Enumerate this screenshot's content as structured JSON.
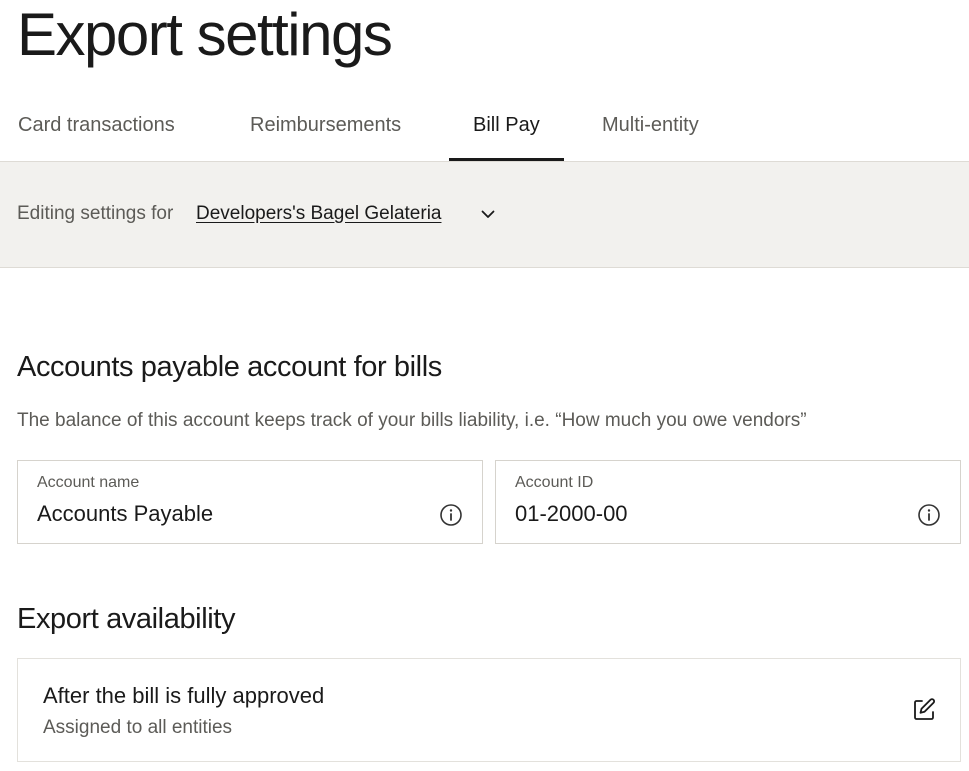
{
  "page": {
    "title": "Export settings"
  },
  "tabs": [
    {
      "label": "Card transactions",
      "active": false
    },
    {
      "label": "Reimbursements",
      "active": false
    },
    {
      "label": "Bill Pay",
      "active": true
    },
    {
      "label": "Multi-entity",
      "active": false
    }
  ],
  "entity_bar": {
    "prefix": "Editing settings for",
    "entity_name": "Developers's Bagel Gelateria",
    "dropdown_icon": "chevron-down-icon"
  },
  "ap_section": {
    "title": "Accounts payable account for bills",
    "description": "The balance of this account keeps track of your bills liability, i.e. “How much you owe vendors”",
    "fields": [
      {
        "label": "Account name",
        "value": "Accounts Payable",
        "icon": "info-icon"
      },
      {
        "label": "Account ID",
        "value": "01-2000-00",
        "icon": "info-icon"
      }
    ]
  },
  "availability_section": {
    "title": "Export availability",
    "card": {
      "title": "After the bill is fully approved",
      "subtitle": "Assigned to all entities",
      "icon": "edit-icon"
    }
  },
  "colors": {
    "text_primary": "#1a1a1a",
    "text_secondary": "#5c5b57",
    "entity_bar_bg": "#f2f1ee",
    "border": "#d6d3cd"
  }
}
